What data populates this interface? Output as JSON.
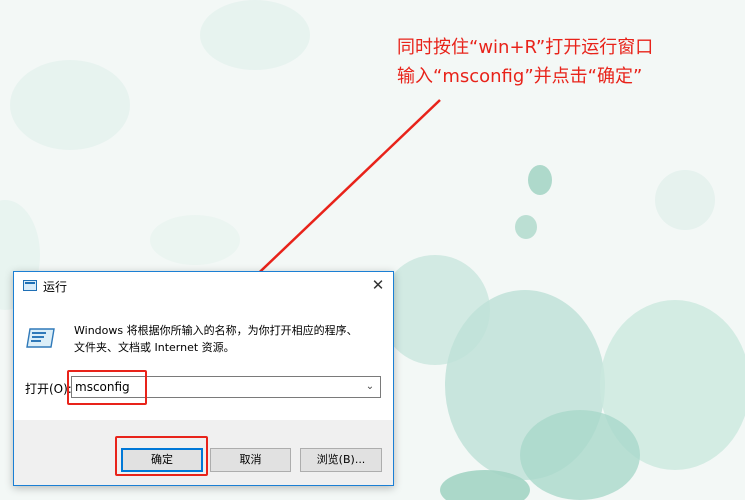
{
  "annotation": {
    "line1": "同时按住“win+R”打开运行窗口",
    "line2": "输入“msconfig”并点击“确定”"
  },
  "dialog": {
    "title": "运行",
    "close_glyph": "✕",
    "description_line1": "Windows 将根据你所输入的名称，为你打开相应的程序、",
    "description_line2": "文件夹、文档或 Internet 资源。",
    "open_label": "打开(O):",
    "command_value": "msconfig",
    "dropdown_glyph": "⌄",
    "buttons": {
      "ok": "确定",
      "cancel": "取消",
      "browse": "浏览(B)..."
    }
  },
  "colors": {
    "annotation_red": "#e8231a",
    "accent_blue": "#0078d7"
  },
  "icons": [
    "run-app-icon",
    "run-large-icon",
    "close-icon",
    "chevron-down-icon",
    "arrow-icon"
  ]
}
